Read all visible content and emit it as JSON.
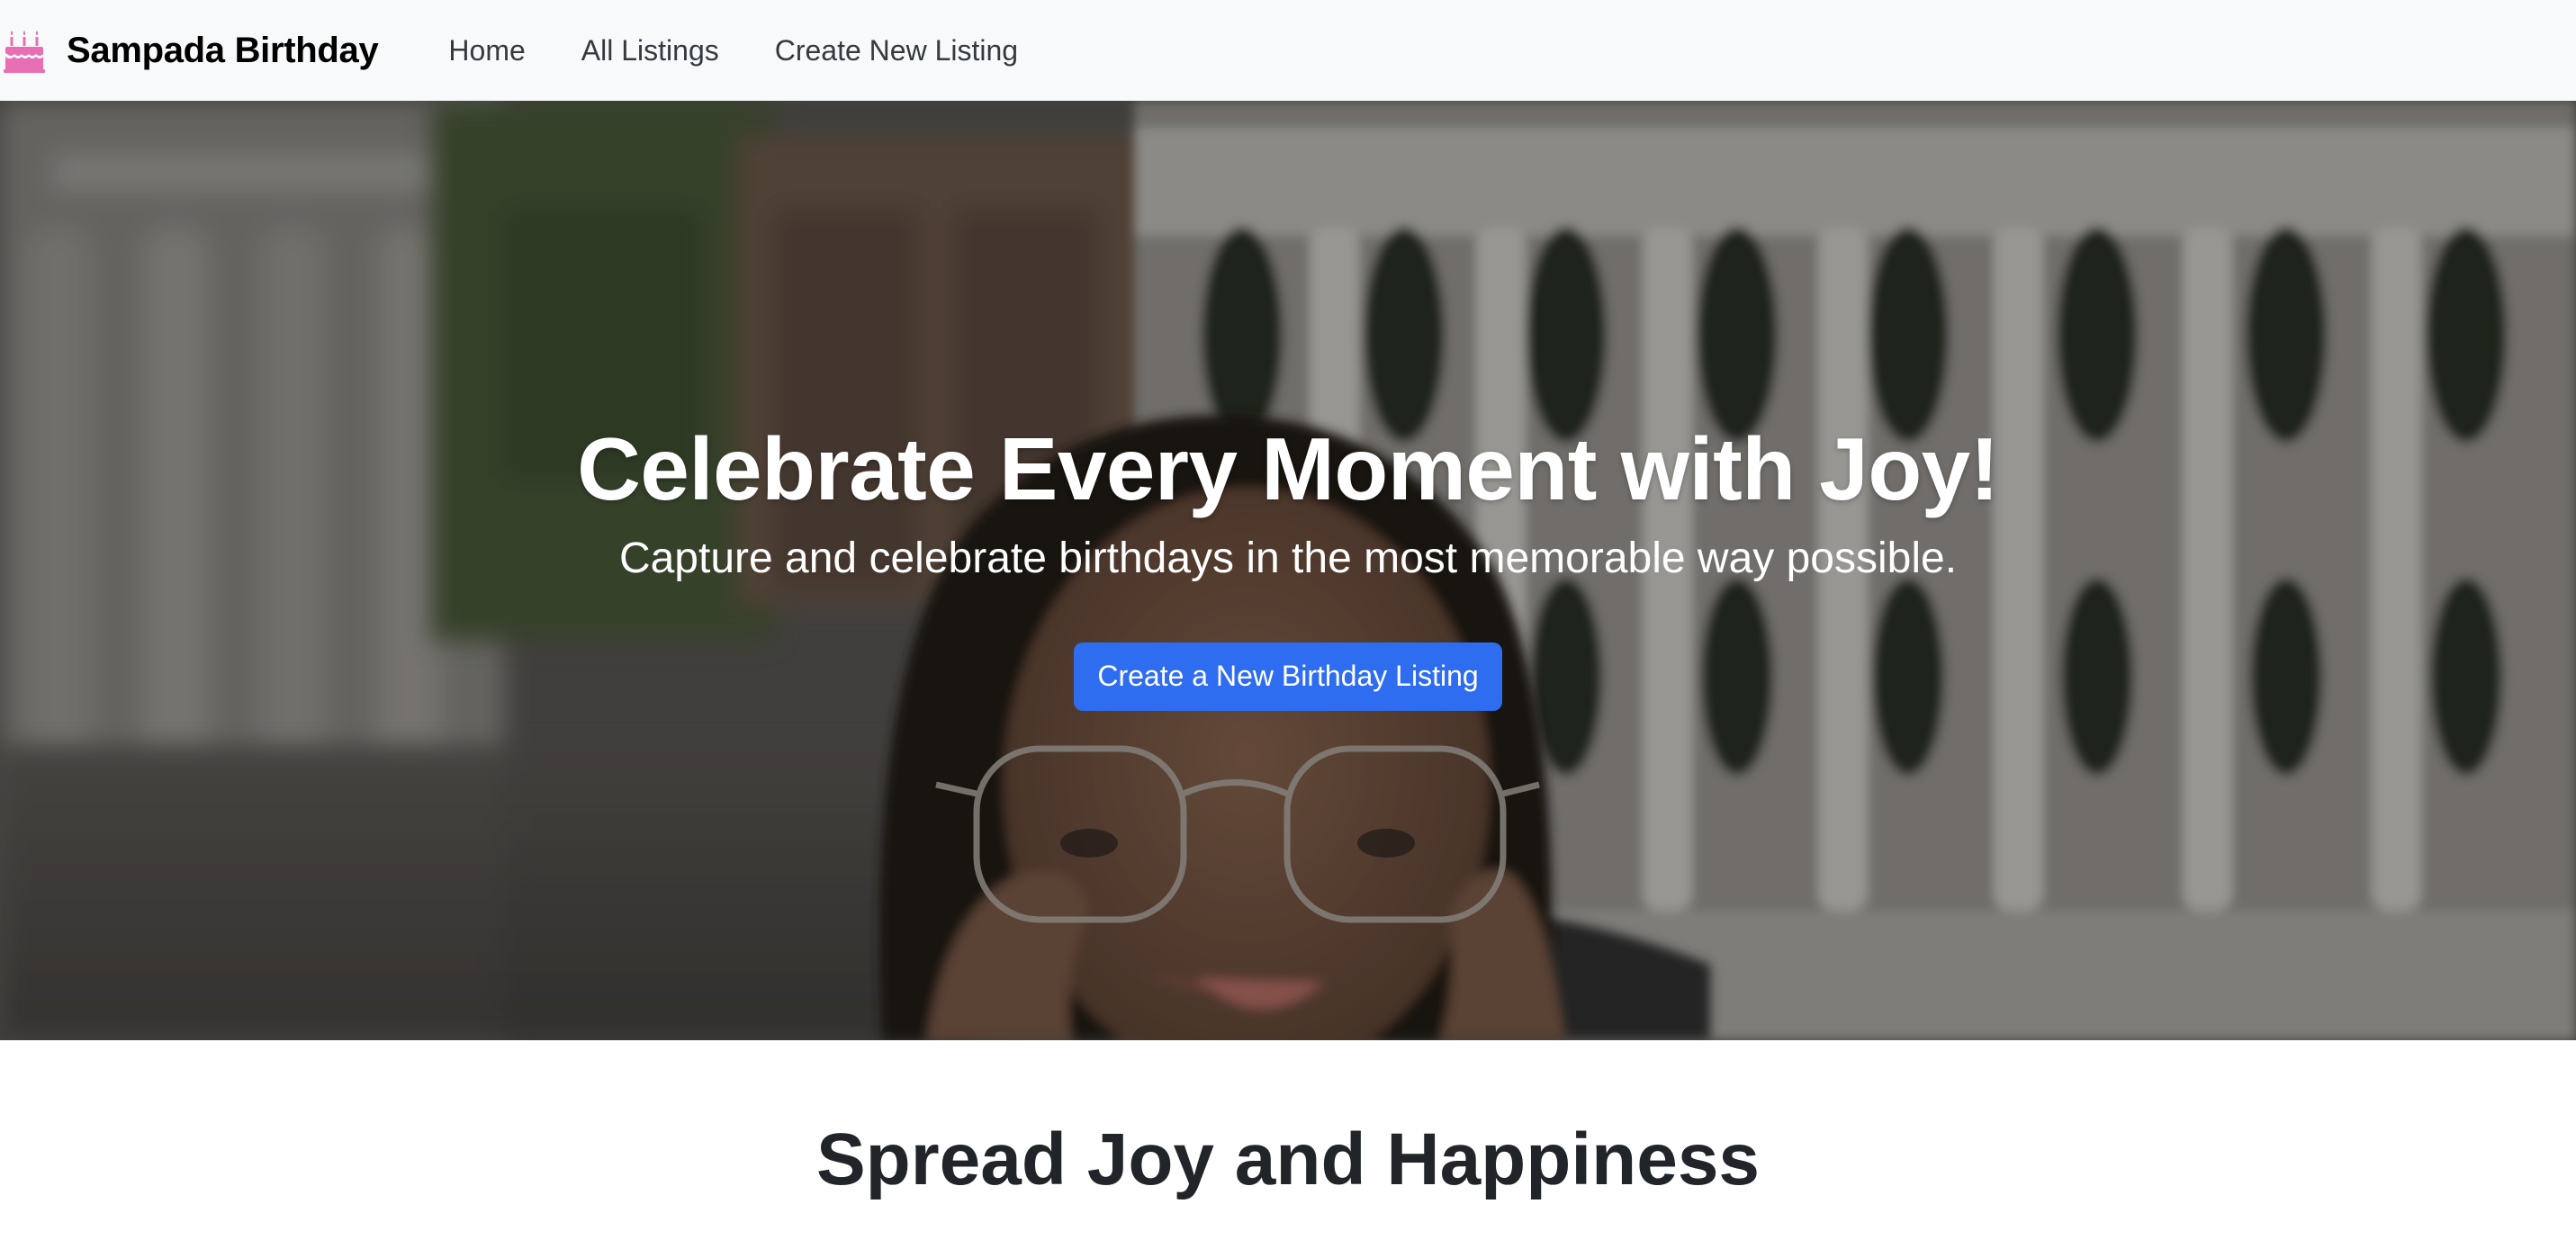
{
  "navbar": {
    "brand_icon": "birthday-cake-icon",
    "brand_icon_color": "#e86fb4",
    "brand_name": "Sampada Birthday",
    "links": [
      {
        "label": "Home"
      },
      {
        "label": "All Listings"
      },
      {
        "label": "Create New Listing"
      }
    ]
  },
  "hero": {
    "title": "Celebrate Every Moment with Joy!",
    "subtitle": "Capture and celebrate birthdays in the most memorable way possible.",
    "button_label": "Create a New Birthday Listing",
    "button_color": "#2f6df0"
  },
  "section": {
    "title": "Spread Joy and Happiness"
  }
}
